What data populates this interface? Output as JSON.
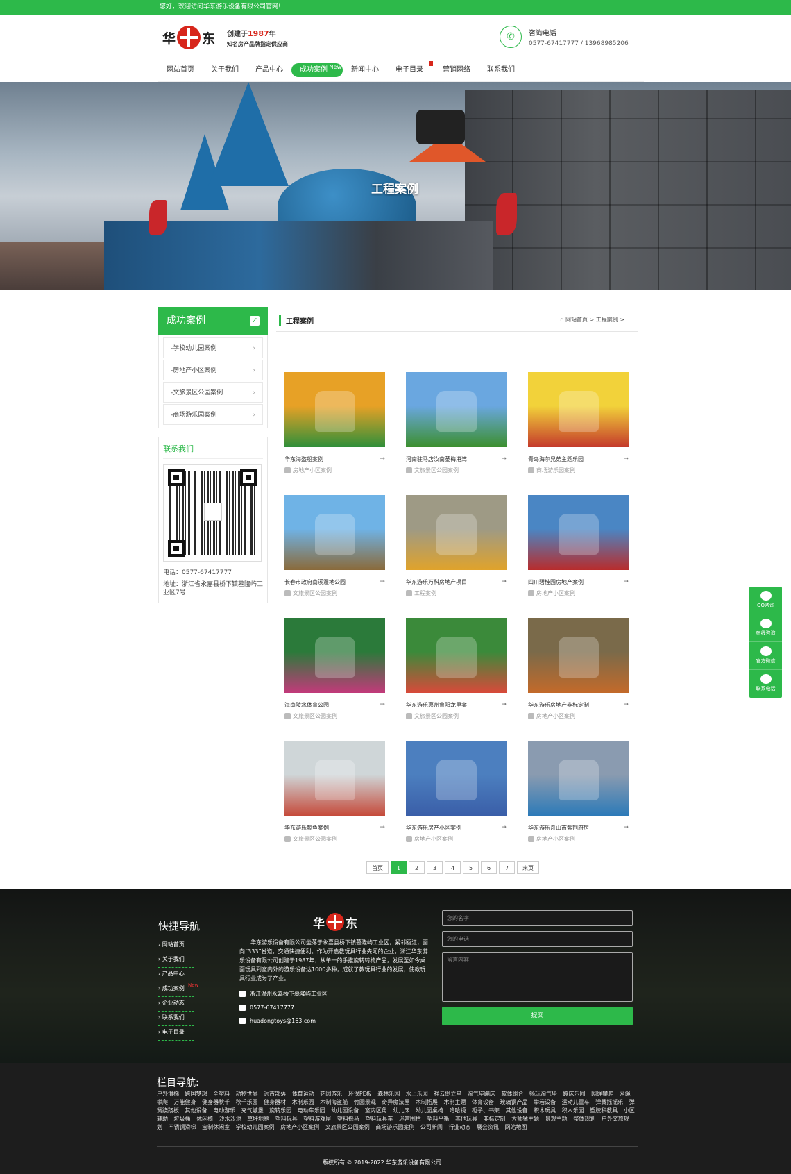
{
  "topbar": {
    "welcome": "您好，欢迎访问华东游乐设备有限公司官网!"
  },
  "header": {
    "logo_hua": "华",
    "logo_dong": "东",
    "slogan_prefix": "创建于",
    "slogan_year": "1987",
    "slogan_suffix": "年",
    "slogan2": "知名房产品牌指定供应商",
    "phone_label": "咨询电话",
    "phone_numbers": "0577-67417777 / 13968985206"
  },
  "nav": {
    "items": [
      {
        "label": "网站首页"
      },
      {
        "label": "关于我们"
      },
      {
        "label": "产品中心"
      },
      {
        "label": "成功案例",
        "badge": "New"
      },
      {
        "label": "新闻中心"
      },
      {
        "label": "电子目录"
      },
      {
        "label": "营销网络"
      },
      {
        "label": "联系我们"
      }
    ]
  },
  "banner": {
    "title": "工程案例"
  },
  "sidebar": {
    "title": "成功案例",
    "items": [
      {
        "label": "-学校幼儿园案例"
      },
      {
        "label": "-房地产小区案例"
      },
      {
        "label": "-文旅景区公园案例"
      },
      {
        "label": "-商场游乐园案例"
      }
    ],
    "contact_title": "联系我们",
    "tel": "电话：0577-67417777",
    "addr": "地址：浙江省永嘉县桥下镇墓隆屿工业区7号"
  },
  "content": {
    "title": "工程案例",
    "breadcrumb": "网站首页 > 工程案例 >"
  },
  "cases": [
    {
      "name": "华东海盗船案例",
      "cat": "房地产小区案例",
      "c1": "#e7a126",
      "c2": "#2f8f3a"
    },
    {
      "name": "河南驻马店汝南萎梅港湾",
      "cat": "文旅景区公园案例",
      "c1": "#6aa7e0",
      "c2": "#3c8f2e"
    },
    {
      "name": "青岛海尔兄弟主题乐园",
      "cat": "商场游乐园案例",
      "c1": "#f2d23a",
      "c2": "#c43a2b"
    },
    {
      "name": "长春市政府南溪湿地公园",
      "cat": "文旅景区公园案例",
      "c1": "#6fb3e6",
      "c2": "#8a6a3a"
    },
    {
      "name": "华东游乐万科房地产项目",
      "cat": "工程案例",
      "c1": "#9e9a85",
      "c2": "#e0a32b"
    },
    {
      "name": "四川碧桂园房地产案例",
      "cat": "房地产小区案例",
      "c1": "#4a86c4",
      "c2": "#b82c2c"
    },
    {
      "name": "海南陵水体育公园",
      "cat": "文旅景区公园案例",
      "c1": "#2b7a3a",
      "c2": "#c23a7a"
    },
    {
      "name": "华东游乐惠州鲁阳龙里案",
      "cat": "文旅景区公园案例",
      "c1": "#3b8a3a",
      "c2": "#d84a3a"
    },
    {
      "name": "华东游乐房地产非标定制",
      "cat": "房地产小区案例",
      "c1": "#7a6a4a",
      "c2": "#c36a2a"
    },
    {
      "name": "华东游乐鲸鱼案例",
      "cat": "文旅景区公园案例",
      "c1": "#cfd6d8",
      "c2": "#c54a3a"
    },
    {
      "name": "华东游乐房产小区案例",
      "cat": "房地产小区案例",
      "c1": "#4c7fbf",
      "c2": "#3a5ea8"
    },
    {
      "name": "华东游乐舟山市紫荆府房",
      "cat": "房地产小区案例",
      "c1": "#8a9bb0",
      "c2": "#2c7ab8"
    }
  ],
  "pager": {
    "first": "首页",
    "pages": [
      "1",
      "2",
      "3",
      "4",
      "5",
      "6",
      "7"
    ],
    "last": "末页",
    "current": "1"
  },
  "footer": {
    "quick_title": "快捷导航",
    "quick_items": [
      "网站首页",
      "关于我们",
      "产品中心",
      "成功案例",
      "企业动态",
      "联系我们",
      "电子目录"
    ],
    "quick_badge": "New",
    "desc": "华东游乐设备有限公司坐落于永嘉县桥下镇墓隆屿工业区，紧邻瓯江，面向“333”省道，交通快捷便利。作为开启教玩具行业先河的企业，浙江华东游乐设备有限公司创建于1987年，从单一的手推旋转转椅产品，发展至如今桌面玩具到室内外的游乐设备达1000多种，成就了教玩具行业的发展，使教玩具行业成为了产业。",
    "address": "浙江温州永嘉桥下墓隆屿工业区",
    "phone": "0577-67417777",
    "email": "huadongtoys@163.com",
    "form_name": "您的名字",
    "form_phone": "您的电话",
    "form_msg": "留言内容",
    "form_submit": "提交"
  },
  "bottom": {
    "title": "栏目导航:",
    "links": [
      "户外滑梯",
      "跨国梦想",
      "全塑料",
      "动物世界",
      "远古部落",
      "体育运动",
      "花园游乐",
      "环保PE板",
      "森林乐园",
      "水上乐园",
      "祥云倒立星",
      "淘气堡蹦床",
      "软体组合",
      "畅玩淘气堡",
      "蹦床乐园",
      "网绳攀爬",
      "网绳攀爬",
      "万能健身",
      "健身器秋千",
      "秋千乐园",
      "健身器材",
      "木制乐园",
      "木制海盗船",
      "竹园景观",
      "奇异魔法屋",
      "木制拓展",
      "木制主题",
      "体育设备",
      "玻璃钢产品",
      "攀岩设备",
      "运动儿童车",
      "弹簧摇摇乐",
      "弹簧跷跷板",
      "其他设备",
      "电动游乐",
      "充气城堡",
      "旋转乐园",
      "电动车乐园",
      "幼儿园设备",
      "室内区角",
      "幼儿床",
      "幼儿园桌椅",
      "哈哈镜",
      "柜子、书架",
      "其他设备",
      "积木玩具",
      "积木乐园",
      "塑胶积教具",
      "小区辅助",
      "垃圾桶",
      "休闲椅",
      "沙水沙池",
      "草坪地毯",
      "塑料玩具",
      "塑料游戏屋",
      "塑料摇马",
      "塑料玩具车",
      "迷宫围栏",
      "塑料平衡",
      "其他玩具",
      "非标定制",
      "大师猛主题",
      "景观主题",
      "整体规划",
      "户外文旅规划",
      "不锈钢滑梯",
      "宝制休闲室",
      "学校幼儿园案例",
      "房地产小区案例",
      "文旅景区公园案例",
      "商场游乐园案例",
      "公司新闻",
      "行业动态",
      "展会资讯",
      "网站地图"
    ],
    "copyright": "版权所有 © 2019-2022 华东游乐设备有限公司"
  },
  "floatbar": {
    "items": [
      "QQ咨询",
      "在线咨询",
      "官方微信",
      "联系电话"
    ]
  }
}
